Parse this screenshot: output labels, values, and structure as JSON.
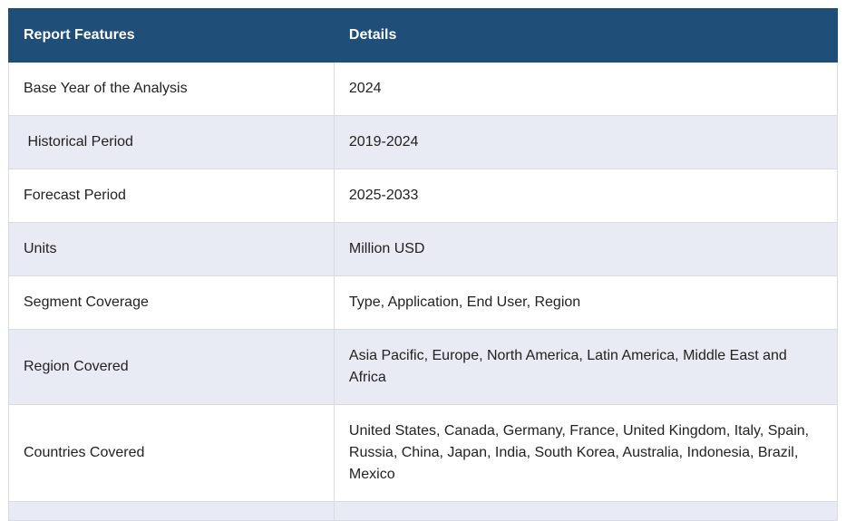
{
  "table": {
    "headers": {
      "feature": "Report Features",
      "details": "Details"
    },
    "rows": [
      {
        "feature": "Base Year of the Analysis",
        "details": "2024"
      },
      {
        "feature": " Historical Period",
        "details": "2019-2024"
      },
      {
        "feature": "Forecast Period",
        "details": "2025-2033"
      },
      {
        "feature": "Units",
        "details": "Million USD"
      },
      {
        "feature": "Segment Coverage",
        "details": "Type, Application, End User, Region"
      },
      {
        "feature": "Region Covered",
        "details": "Asia Pacific, Europe, North America, Latin America, Middle East and Africa"
      },
      {
        "feature": "Countries Covered",
        "details": "United States, Canada, Germany, France, United Kingdom, Italy, Spain, Russia, China, Japan, India, South Korea, Australia, Indonesia, Brazil, Mexico"
      }
    ]
  },
  "colors": {
    "header_bg": "#1f4e79",
    "alt_row_bg": "#e8eaf4",
    "border": "#d9dbe3"
  }
}
